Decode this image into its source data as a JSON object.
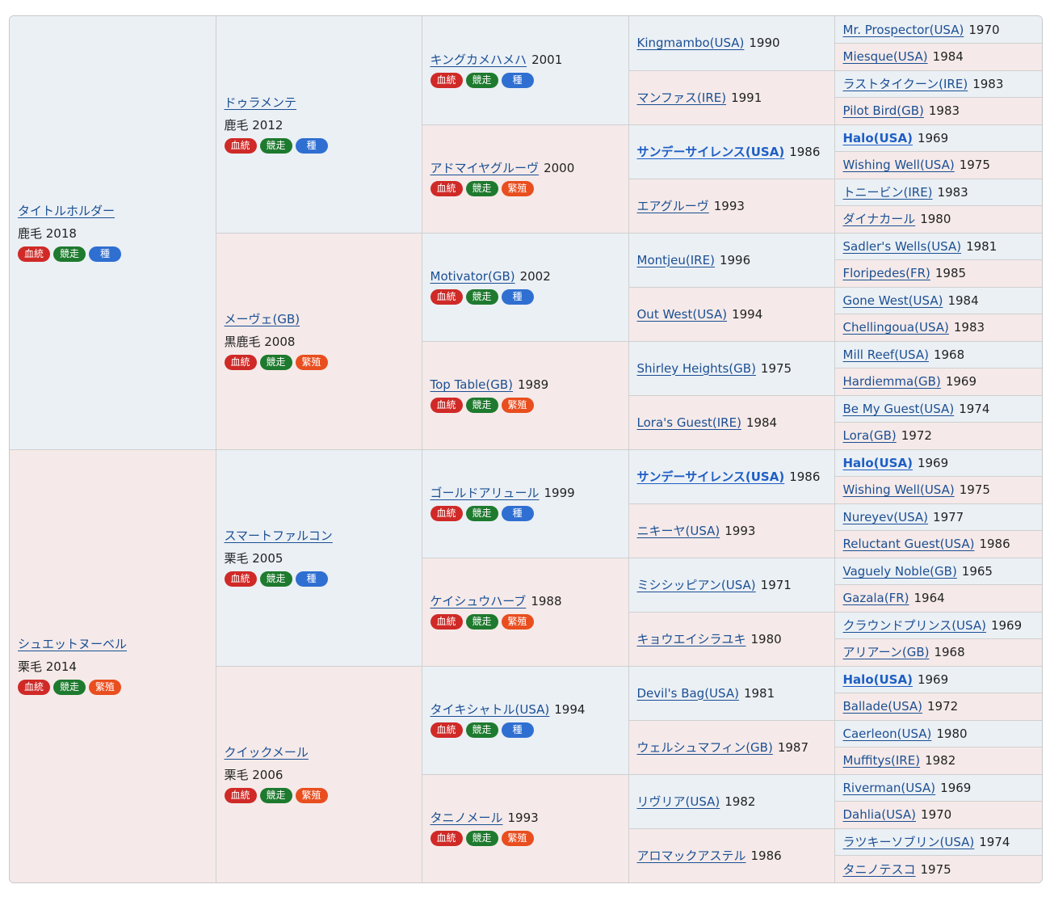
{
  "badge_labels": {
    "pedigree": "血統",
    "race": "競走",
    "stallion": "種",
    "breed": "繁殖"
  },
  "colors": {
    "male_bg": "#ebf0f5",
    "female_bg": "#f5eae9",
    "link": "#1b4f93",
    "pedigree_badge": "#cf2a27",
    "race_badge": "#1e7a2e",
    "stallion_badge": "#2f6fd1",
    "breed_badge": "#e94e1f"
  },
  "gen1": [
    {
      "name": "タイトルホルダー",
      "coat_year": "鹿毛 2018",
      "badges": [
        "pedigree",
        "race",
        "stallion"
      ]
    },
    {
      "name": "シュエットヌーベル",
      "coat_year": "栗毛 2014",
      "badges": [
        "pedigree",
        "race",
        "breed"
      ]
    }
  ],
  "gen2": [
    {
      "name": "ドゥラメンテ",
      "coat_year": "鹿毛 2012",
      "badges": [
        "pedigree",
        "race",
        "stallion"
      ]
    },
    {
      "name": "メーヴェ(GB)",
      "coat_year": "黒鹿毛 2008",
      "badges": [
        "pedigree",
        "race",
        "breed"
      ]
    },
    {
      "name": "スマートファルコン",
      "coat_year": "栗毛 2005",
      "badges": [
        "pedigree",
        "race",
        "stallion"
      ]
    },
    {
      "name": "クイックメール",
      "coat_year": "栗毛 2006",
      "badges": [
        "pedigree",
        "race",
        "breed"
      ]
    }
  ],
  "gen3": [
    {
      "name": "キングカメハメハ",
      "year": "2001",
      "badges": [
        "pedigree",
        "race",
        "stallion"
      ]
    },
    {
      "name": "アドマイヤグルーヴ",
      "year": "2000",
      "badges": [
        "pedigree",
        "race",
        "breed"
      ]
    },
    {
      "name": "Motivator(GB)",
      "year": "2002",
      "badges": [
        "pedigree",
        "race",
        "stallion"
      ]
    },
    {
      "name": "Top Table(GB)",
      "year": "1989",
      "badges": [
        "pedigree",
        "race",
        "breed"
      ]
    },
    {
      "name": "ゴールドアリュール",
      "year": "1999",
      "badges": [
        "pedigree",
        "race",
        "stallion"
      ]
    },
    {
      "name": "ケイシュウハーブ",
      "year": "1988",
      "badges": [
        "pedigree",
        "race",
        "breed"
      ]
    },
    {
      "name": "タイキシャトル(USA)",
      "year": "1994",
      "badges": [
        "pedigree",
        "race",
        "stallion"
      ]
    },
    {
      "name": "タニノメール",
      "year": "1993",
      "badges": [
        "pedigree",
        "race",
        "breed"
      ]
    }
  ],
  "gen4": [
    {
      "name": "Kingmambo(USA)",
      "year": "1990",
      "bold": false
    },
    {
      "name": "マンファス(IRE)",
      "year": "1991",
      "bold": false
    },
    {
      "name": "サンデーサイレンス(USA)",
      "year": "1986",
      "bold": true
    },
    {
      "name": "エアグルーヴ",
      "year": "1993",
      "bold": false
    },
    {
      "name": "Montjeu(IRE)",
      "year": "1996",
      "bold": false
    },
    {
      "name": "Out West(USA)",
      "year": "1994",
      "bold": false
    },
    {
      "name": "Shirley Heights(GB)",
      "year": "1975",
      "bold": false
    },
    {
      "name": "Lora's Guest(IRE)",
      "year": "1984",
      "bold": false
    },
    {
      "name": "サンデーサイレンス(USA)",
      "year": "1986",
      "bold": true
    },
    {
      "name": "ニキーヤ(USA)",
      "year": "1993",
      "bold": false
    },
    {
      "name": "ミシシッピアン(USA)",
      "year": "1971",
      "bold": false
    },
    {
      "name": "キョウエイシラユキ",
      "year": "1980",
      "bold": false
    },
    {
      "name": "Devil's Bag(USA)",
      "year": "1981",
      "bold": false
    },
    {
      "name": "ウェルシュマフィン(GB)",
      "year": "1987",
      "bold": false
    },
    {
      "name": "リヴリア(USA)",
      "year": "1982",
      "bold": false
    },
    {
      "name": "アロマックアステル",
      "year": "1986",
      "bold": false
    }
  ],
  "gen5": [
    {
      "name": "Mr. Prospector(USA)",
      "year": "1970",
      "bold": false
    },
    {
      "name": "Miesque(USA)",
      "year": "1984",
      "bold": false
    },
    {
      "name": "ラストタイクーン(IRE)",
      "year": "1983",
      "bold": false
    },
    {
      "name": "Pilot Bird(GB)",
      "year": "1983",
      "bold": false
    },
    {
      "name": "Halo(USA)",
      "year": "1969",
      "bold": true
    },
    {
      "name": "Wishing Well(USA)",
      "year": "1975",
      "bold": false
    },
    {
      "name": "トニービン(IRE)",
      "year": "1983",
      "bold": false
    },
    {
      "name": "ダイナカール",
      "year": "1980",
      "bold": false
    },
    {
      "name": "Sadler's Wells(USA)",
      "year": "1981",
      "bold": false
    },
    {
      "name": "Floripedes(FR)",
      "year": "1985",
      "bold": false
    },
    {
      "name": "Gone West(USA)",
      "year": "1984",
      "bold": false
    },
    {
      "name": "Chellingoua(USA)",
      "year": "1983",
      "bold": false
    },
    {
      "name": "Mill Reef(USA)",
      "year": "1968",
      "bold": false
    },
    {
      "name": "Hardiemma(GB)",
      "year": "1969",
      "bold": false
    },
    {
      "name": "Be My Guest(USA)",
      "year": "1974",
      "bold": false
    },
    {
      "name": "Lora(GB)",
      "year": "1972",
      "bold": false
    },
    {
      "name": "Halo(USA)",
      "year": "1969",
      "bold": true
    },
    {
      "name": "Wishing Well(USA)",
      "year": "1975",
      "bold": false
    },
    {
      "name": "Nureyev(USA)",
      "year": "1977",
      "bold": false
    },
    {
      "name": "Reluctant Guest(USA)",
      "year": "1986",
      "bold": false
    },
    {
      "name": "Vaguely Noble(GB)",
      "year": "1965",
      "bold": false
    },
    {
      "name": "Gazala(FR)",
      "year": "1964",
      "bold": false
    },
    {
      "name": "クラウンドプリンス(USA)",
      "year": "1969",
      "bold": false
    },
    {
      "name": "アリアーン(GB)",
      "year": "1968",
      "bold": false
    },
    {
      "name": "Halo(USA)",
      "year": "1969",
      "bold": true
    },
    {
      "name": "Ballade(USA)",
      "year": "1972",
      "bold": false
    },
    {
      "name": "Caerleon(USA)",
      "year": "1980",
      "bold": false
    },
    {
      "name": "Muffitys(IRE)",
      "year": "1982",
      "bold": false
    },
    {
      "name": "Riverman(USA)",
      "year": "1969",
      "bold": false
    },
    {
      "name": "Dahlia(USA)",
      "year": "1970",
      "bold": false
    },
    {
      "name": "ラツキーソブリン(USA)",
      "year": "1974",
      "bold": false
    },
    {
      "name": "タニノテスコ",
      "year": "1975",
      "bold": false
    }
  ]
}
